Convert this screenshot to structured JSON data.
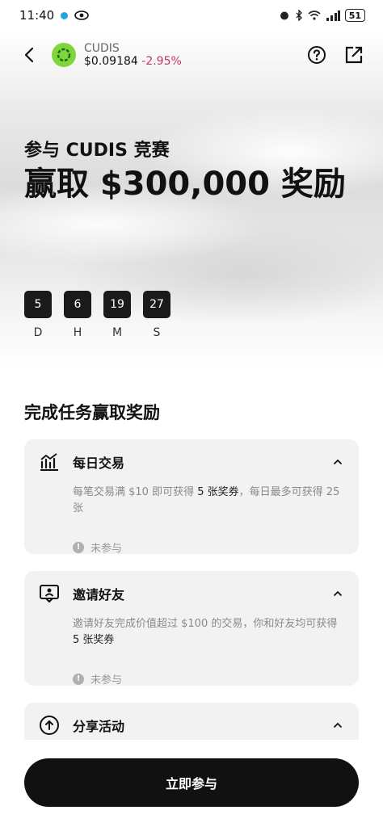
{
  "status_bar": {
    "time": "11:40",
    "battery": "51"
  },
  "token": {
    "name": "CUDIS",
    "price": "$0.09184",
    "change": "-2.95%"
  },
  "hero": {
    "subtitle": "参与 CUDIS 竞赛",
    "title": "赢取 $300,000 奖励"
  },
  "countdown": [
    {
      "value": "5",
      "label": "D"
    },
    {
      "value": "6",
      "label": "H"
    },
    {
      "value": "19",
      "label": "M"
    },
    {
      "value": "27",
      "label": "S"
    }
  ],
  "tasks_section": {
    "title": "完成任务赢取奖励"
  },
  "tasks": [
    {
      "title": "每日交易",
      "desc_pre": "每笔交易满 $10 即可获得 ",
      "desc_bold": "5 张奖券",
      "desc_post": "，每日最多可获得 25 张",
      "status": "未参与",
      "icon": "chart-icon"
    },
    {
      "title": "邀请好友",
      "desc_pre": "邀请好友完成价值超过 $100 的交易，你和好友均可获得 ",
      "desc_bold": "5 张奖券",
      "desc_post": "",
      "status": "未参与",
      "icon": "invite-icon"
    },
    {
      "title": "分享活动",
      "icon": "share-icon"
    }
  ],
  "join_button": {
    "label": "立即参与"
  },
  "colors": {
    "token_green": "#7fd63a",
    "change_red": "#c0366a",
    "button_black": "#111111"
  }
}
